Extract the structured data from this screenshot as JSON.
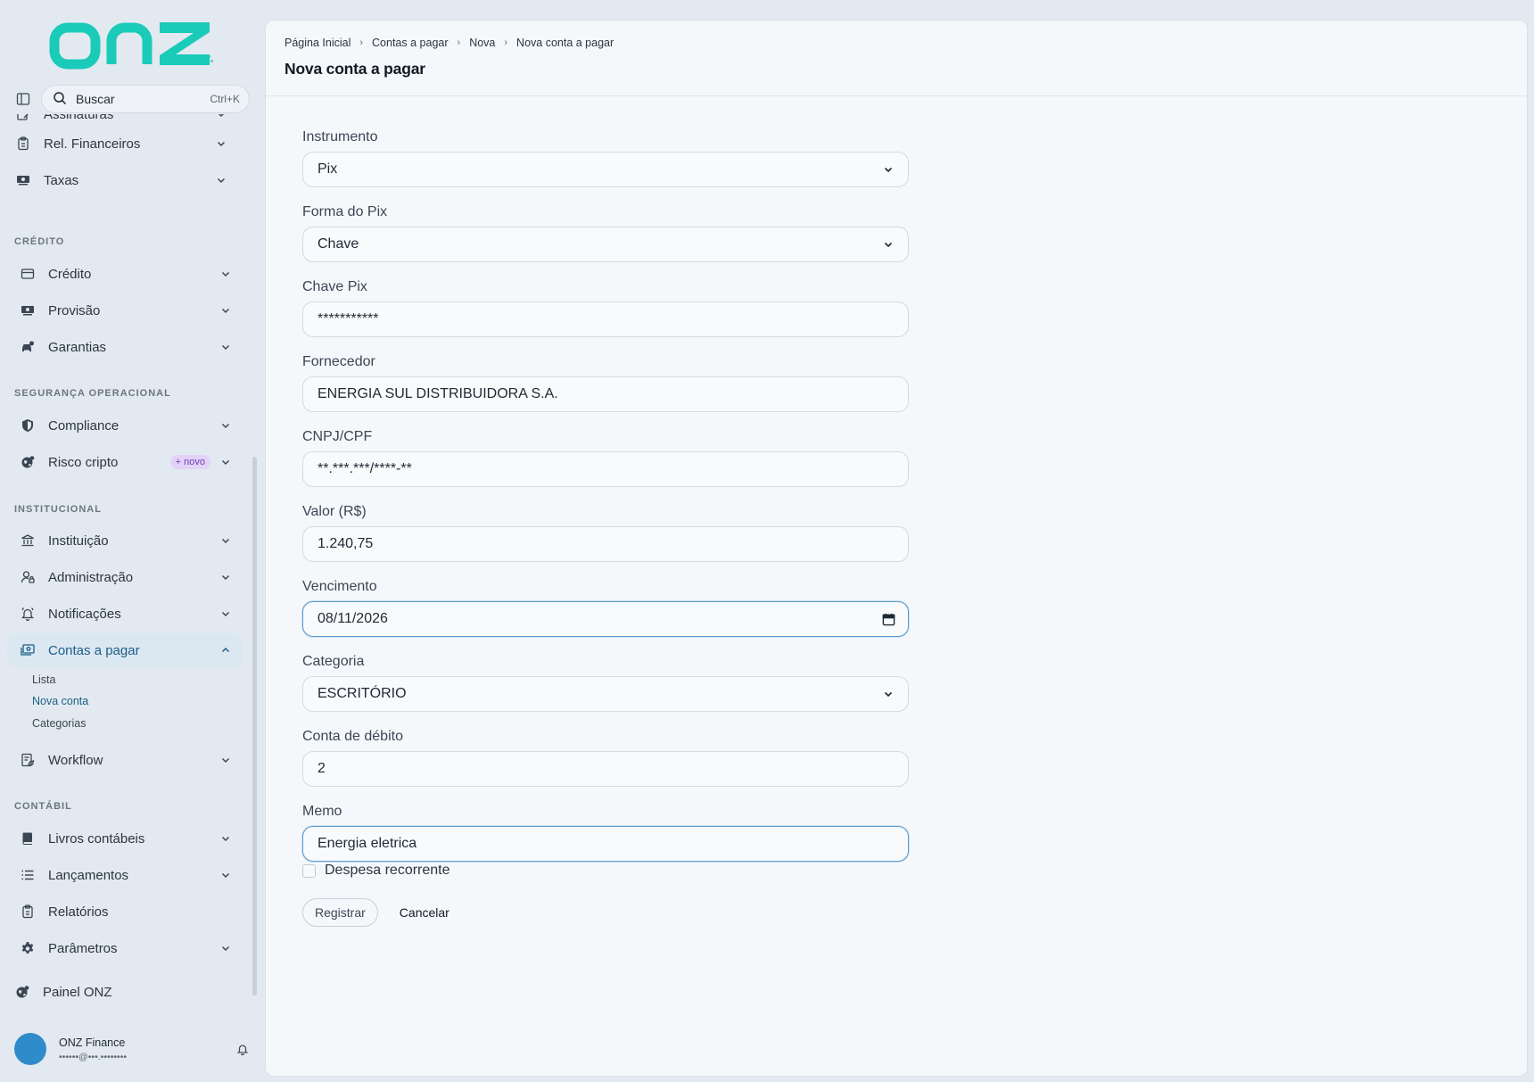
{
  "brand": {
    "logo_text": "onz",
    "color": "#19cbb8"
  },
  "search": {
    "label": "Buscar",
    "shortcut": "Ctrl+K"
  },
  "nav": {
    "top_items": [
      {
        "label": "Assinaturas",
        "icon": "signature-icon"
      },
      {
        "label": "Rel. Financeiros",
        "icon": "clipboard-icon"
      },
      {
        "label": "Taxas",
        "icon": "money-icon"
      }
    ],
    "sections": {
      "credito": "CRÉDITO",
      "seguranca": "SEGURANÇA OPERACIONAL",
      "institucional": "INSTITUCIONAL",
      "contabil": "CONTÁBIL"
    },
    "credito_items": [
      {
        "label": "Crédito",
        "icon": "card-icon"
      },
      {
        "label": "Provisão",
        "icon": "money-icon"
      },
      {
        "label": "Garantias",
        "icon": "car-icon"
      }
    ],
    "seguranca_items": [
      {
        "label": "Compliance",
        "icon": "shield-icon"
      },
      {
        "label": "Risco cripto",
        "icon": "globe-icon",
        "badge": "+ novo"
      }
    ],
    "institucional_items": [
      {
        "label": "Instituição",
        "icon": "bank-icon"
      },
      {
        "label": "Administração",
        "icon": "user-lock-icon"
      },
      {
        "label": "Notificações",
        "icon": "bell-icon"
      },
      {
        "label": "Contas a pagar",
        "icon": "bill-icon"
      }
    ],
    "contas_sub": [
      "Lista",
      "Nova conta",
      "Categorias"
    ],
    "workflow": {
      "label": "Workflow",
      "icon": "workflow-icon"
    },
    "contabil_items": [
      {
        "label": "Livros contábeis",
        "icon": "book-icon"
      },
      {
        "label": "Lançamentos",
        "icon": "list-icon"
      },
      {
        "label": "Relatórios",
        "icon": "clipboard-icon"
      },
      {
        "label": "Parâmetros",
        "icon": "gear-icon"
      }
    ],
    "footer_link": "Painel ONZ"
  },
  "user": {
    "name": "ONZ Finance",
    "email": "••••••@•••.••••••••"
  },
  "breadcrumb": [
    "Página Inicial",
    "Contas a pagar",
    "Nova",
    "Nova conta a pagar"
  ],
  "page_title": "Nova conta a pagar",
  "form": {
    "instrumento": {
      "label": "Instrumento",
      "value": "Pix"
    },
    "forma_pix": {
      "label": "Forma do Pix",
      "value": "Chave"
    },
    "chave_pix": {
      "label": "Chave Pix",
      "value": "***********"
    },
    "fornecedor": {
      "label": "Fornecedor",
      "value": "ENERGIA SUL DISTRIBUIDORA S.A."
    },
    "cnpj": {
      "label": "CNPJ/CPF",
      "value": "**.***.***/****-**"
    },
    "valor": {
      "label": "Valor (R$)",
      "value": "1.240,75"
    },
    "vencimento": {
      "label": "Vencimento",
      "value": "08/11/2026"
    },
    "categoria": {
      "label": "Categoria",
      "value": "ESCRITÓRIO"
    },
    "conta_debito": {
      "label": "Conta de débito",
      "value": "2"
    },
    "memo": {
      "label": "Memo",
      "value": "Energia eletrica"
    },
    "recorrente": {
      "label": "Despesa recorrente",
      "checked": false
    },
    "submit": "Registrar",
    "cancel": "Cancelar"
  }
}
